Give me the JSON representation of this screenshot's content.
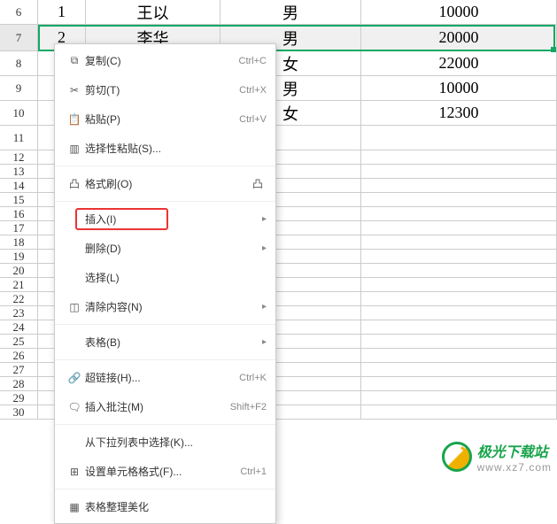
{
  "rows": [
    {
      "num": "6",
      "h": "r-datah",
      "cells": [
        "1",
        "王以",
        "男",
        "10000"
      ]
    },
    {
      "num": "7",
      "h": "r-selected",
      "sel": true,
      "cells": [
        "2",
        "李华",
        "男",
        "20000"
      ]
    },
    {
      "num": "8",
      "h": "r-datah",
      "cells": [
        "",
        "",
        "女",
        "22000"
      ]
    },
    {
      "num": "9",
      "h": "r-datah",
      "cells": [
        "",
        "",
        "男",
        "10000"
      ]
    },
    {
      "num": "10",
      "h": "r-datah",
      "cells": [
        "",
        "",
        "女",
        "12300"
      ]
    },
    {
      "num": "11",
      "h": "r-datah",
      "cells": [
        "",
        "",
        "",
        ""
      ]
    },
    {
      "num": "12",
      "h": "r-short",
      "cells": [
        "",
        "",
        "",
        ""
      ]
    },
    {
      "num": "13",
      "h": "r-short",
      "cells": [
        "",
        "",
        "",
        ""
      ]
    },
    {
      "num": "14",
      "h": "r-short",
      "cells": [
        "",
        "",
        "",
        ""
      ]
    },
    {
      "num": "15",
      "h": "r-short",
      "cells": [
        "",
        "",
        "",
        ""
      ]
    },
    {
      "num": "16",
      "h": "r-short",
      "cells": [
        "",
        "",
        "",
        ""
      ]
    },
    {
      "num": "17",
      "h": "r-short",
      "cells": [
        "",
        "",
        "",
        ""
      ]
    },
    {
      "num": "18",
      "h": "r-short",
      "cells": [
        "",
        "",
        "",
        ""
      ]
    },
    {
      "num": "19",
      "h": "r-short",
      "cells": [
        "",
        "",
        "",
        ""
      ]
    },
    {
      "num": "20",
      "h": "r-short",
      "cells": [
        "",
        "",
        "",
        ""
      ]
    },
    {
      "num": "21",
      "h": "r-short",
      "cells": [
        "",
        "",
        "",
        ""
      ]
    },
    {
      "num": "22",
      "h": "r-short",
      "cells": [
        "",
        "",
        "",
        ""
      ]
    },
    {
      "num": "23",
      "h": "r-short",
      "cells": [
        "",
        "",
        "",
        ""
      ]
    },
    {
      "num": "24",
      "h": "r-short",
      "cells": [
        "",
        "",
        "",
        ""
      ]
    },
    {
      "num": "25",
      "h": "r-short",
      "cells": [
        "",
        "",
        "",
        ""
      ]
    },
    {
      "num": "26",
      "h": "r-short",
      "cells": [
        "",
        "",
        "",
        ""
      ]
    },
    {
      "num": "27",
      "h": "r-short",
      "cells": [
        "",
        "",
        "",
        ""
      ]
    },
    {
      "num": "28",
      "h": "r-short",
      "cells": [
        "",
        "",
        "",
        ""
      ]
    },
    {
      "num": "29",
      "h": "r-short",
      "cells": [
        "",
        "",
        "",
        ""
      ]
    },
    {
      "num": "30",
      "h": "r-short",
      "cells": [
        "",
        "",
        "",
        ""
      ]
    }
  ],
  "menu": {
    "copy": {
      "label": "复制(C)",
      "sc": "Ctrl+C",
      "icon": "⧉"
    },
    "cut": {
      "label": "剪切(T)",
      "sc": "Ctrl+X",
      "icon": "✂"
    },
    "paste": {
      "label": "粘贴(P)",
      "sc": "Ctrl+V",
      "icon": "📋"
    },
    "paste_special": {
      "label": "选择性粘贴(S)...",
      "icon": "▥"
    },
    "format_painter": {
      "label": "格式刷(O)",
      "icon": "凸",
      "extra": "凸"
    },
    "insert": {
      "label": "插入(I)"
    },
    "delete": {
      "label": "删除(D)"
    },
    "select": {
      "label": "选择(L)"
    },
    "clear": {
      "label": "清除内容(N)",
      "icon": "◫"
    },
    "table": {
      "label": "表格(B)"
    },
    "hyperlink": {
      "label": "超链接(H)...",
      "sc": "Ctrl+K",
      "icon": "🔗"
    },
    "comment": {
      "label": "插入批注(M)",
      "sc": "Shift+F2",
      "icon": "🗨"
    },
    "dropdown": {
      "label": "从下拉列表中选择(K)..."
    },
    "cell_format": {
      "label": "设置单元格格式(F)...",
      "sc": "Ctrl+1",
      "icon": "⊞"
    },
    "tidy": {
      "label": "表格整理美化",
      "icon": "▦"
    }
  },
  "watermark": {
    "t1": "极光下载站",
    "t2": "www.xz7.com"
  }
}
